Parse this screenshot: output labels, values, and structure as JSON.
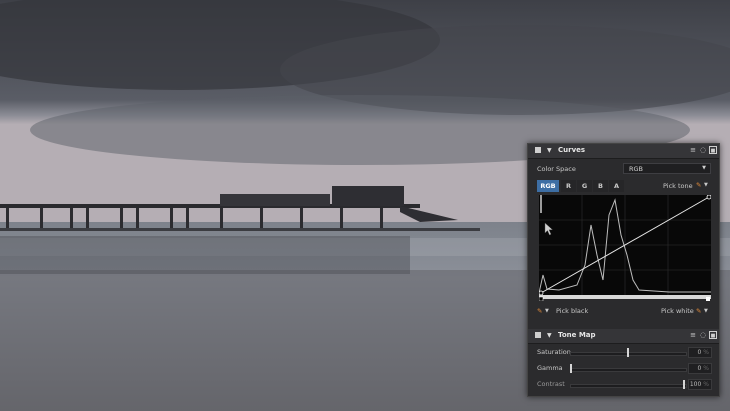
{
  "curves_panel": {
    "title": "Curves",
    "color_space_label": "Color Space",
    "color_space_value": "RGB",
    "channels": [
      "RGB",
      "R",
      "G",
      "B",
      "A"
    ],
    "active_channel": "RGB",
    "pick_tone_label": "Pick tone",
    "pick_black_label": "Pick black",
    "pick_white_label": "Pick white"
  },
  "tone_map_panel": {
    "title": "Tone Map",
    "sliders": [
      {
        "label": "Saturation",
        "value": "0",
        "unit": "%",
        "level": 0.5
      },
      {
        "label": "Gamma",
        "value": "0",
        "unit": "%",
        "level": 0.0
      },
      {
        "label": "Contrast",
        "value": "100",
        "unit": "%",
        "level": 1.0
      }
    ]
  },
  "icons": {
    "menu": "hamburger-icon",
    "reset": "reset-icon",
    "close": "panel-close-icon",
    "eyedropper": "eyedropper-icon"
  }
}
